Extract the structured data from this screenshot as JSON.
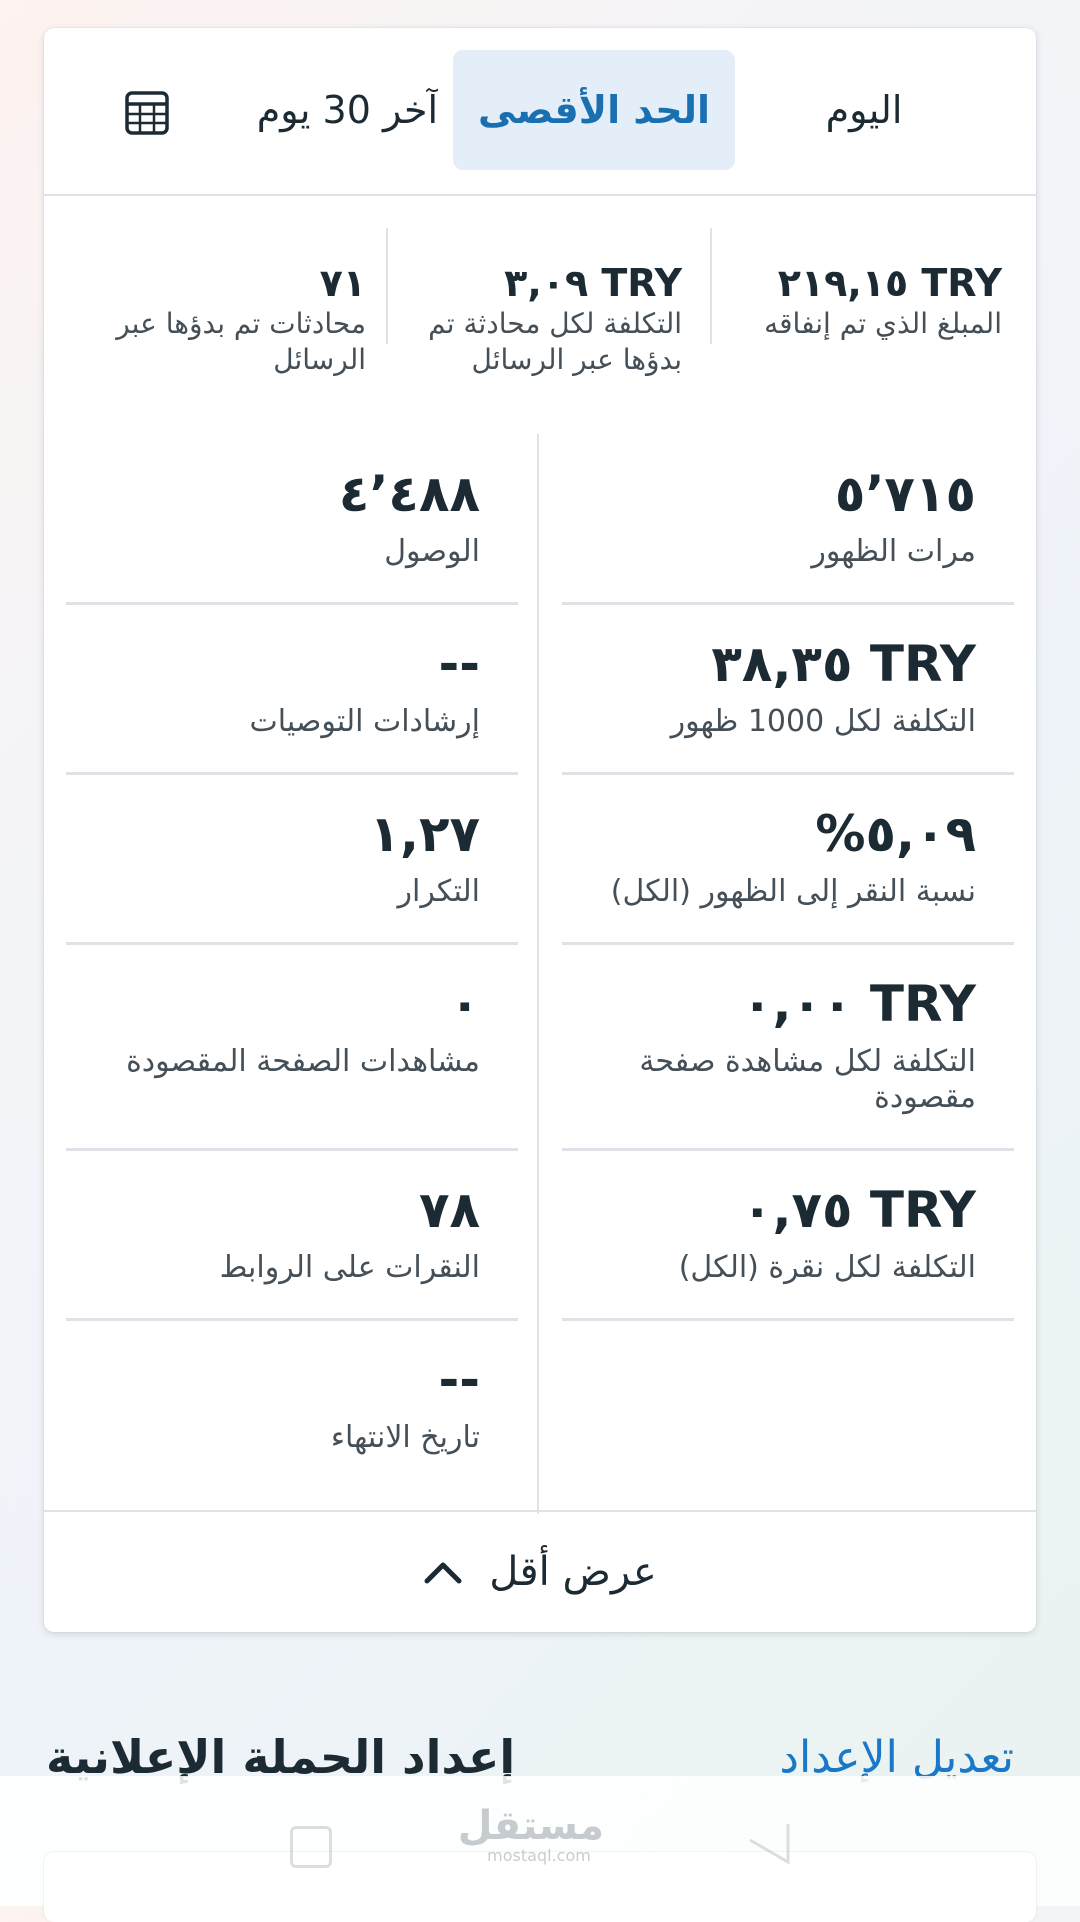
{
  "tabs": {
    "today": "اليوم",
    "maximum": "الحد الأقصى",
    "last30": "آخر 30 يوم"
  },
  "summary": {
    "spent": {
      "value": "TRY ٢١٩,١٥",
      "label": "المبلغ الذي تم إنفاقه"
    },
    "cost_per_conversation": {
      "value": "TRY ٣,٠٩",
      "label": "التكلفة لكل محادثة تم بدؤها عبر الرسائل"
    },
    "conversations": {
      "value": "٧١",
      "label": "محادثات تم بدؤها عبر الرسائل"
    }
  },
  "metrics": {
    "impressions": {
      "value": "٥٬٧١٥",
      "label": "مرات الظهور"
    },
    "reach": {
      "value": "٤٬٤٨٨",
      "label": "الوصول"
    },
    "cpm": {
      "value": "TRY ٣٨,٣٥",
      "label": "التكلفة لكل 1000 ظهور"
    },
    "recommendations": {
      "value": "--",
      "label": "إرشادات التوصيات"
    },
    "ctr": {
      "value": "٥,٠٩%",
      "label": "نسبة النقر إلى الظهور (الكل)"
    },
    "frequency": {
      "value": "١,٢٧",
      "label": "التكرار"
    },
    "cost_per_landing_view": {
      "value": "TRY ٠,٠٠",
      "label": "التكلفة لكل مشاهدة صفحة مقصودة"
    },
    "landing_page_views": {
      "value": "٠",
      "label": "مشاهدات الصفحة المقصودة"
    },
    "cpc": {
      "value": "TRY ٠,٧٥",
      "label": "التكلفة لكل نقرة (الكل)"
    },
    "link_clicks": {
      "value": "٧٨",
      "label": "النقرات على الروابط"
    },
    "end_date": {
      "value": "--",
      "label": "تاريخ الانتهاء"
    }
  },
  "show_less": "عرض أقل",
  "section": {
    "title": "إعداد الحملة الإعلانية",
    "edit": "تعديل الإعداد"
  },
  "watermark": {
    "arabic": "مستقل",
    "latin": "mostaql.com"
  },
  "colors": {
    "accent": "#1a78c8",
    "selected_tab_bg": "#e4eef8",
    "text": "#1c2b33"
  },
  "icons": {
    "calendar": "calendar-icon",
    "chevron": "chevron-up-icon"
  }
}
